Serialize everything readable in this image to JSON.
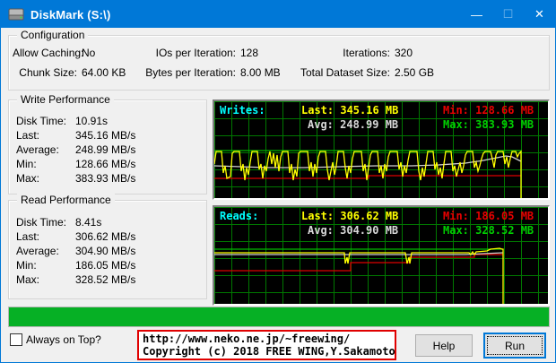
{
  "window": {
    "title": "DiskMark (S:\\)"
  },
  "titlebar": {
    "minimize_glyph": "—",
    "maximize_glyph": "☐",
    "close_glyph": "✕"
  },
  "configuration": {
    "legend": "Configuration",
    "fields": [
      {
        "label": "Allow Caching:",
        "value": "No"
      },
      {
        "label": "Chunk Size:",
        "value": "64.00 KB"
      },
      {
        "label": "IOs per Iteration:",
        "value": "128"
      },
      {
        "label": "Bytes per Iteration:",
        "value": "8.00 MB"
      },
      {
        "label": "Iterations:",
        "value": "320"
      },
      {
        "label": "Total Dataset Size:",
        "value": "2.50 GB"
      }
    ]
  },
  "write_performance": {
    "legend": "Write Performance",
    "rows": [
      {
        "label": "Disk Time:",
        "value": "10.91s"
      },
      {
        "label": "Last:",
        "value": "345.16 MB/s"
      },
      {
        "label": "Average:",
        "value": "248.99 MB/s"
      },
      {
        "label": "Min:",
        "value": "128.66 MB/s"
      },
      {
        "label": "Max:",
        "value": "383.93 MB/s"
      }
    ]
  },
  "read_performance": {
    "legend": "Read Performance",
    "rows": [
      {
        "label": "Disk Time:",
        "value": "8.41s"
      },
      {
        "label": "Last:",
        "value": "306.62 MB/s"
      },
      {
        "label": "Average:",
        "value": "304.90 MB/s"
      },
      {
        "label": "Min:",
        "value": "186.05 MB/s"
      },
      {
        "label": "Max:",
        "value": "328.52 MB/s"
      }
    ]
  },
  "write_graph": {
    "title": "Writes:",
    "last": "Last: 345.16 MB",
    "avg": "Avg: 248.99 MB",
    "min": "Min: 128.66 MB",
    "max": "Max: 383.93 MB",
    "series": {
      "max_line": "0,55 342,55",
      "min_line": "0,86 172,86 172,83 342,83",
      "avg_line": "0,72 30,73 60,74 100,74 140,73 180,72 220,72 250,71 280,69 300,66 315,63 325,61 332,62 338,65 342,67",
      "last_line": "0,70 2,56 8,56 10,80 12,72 14,86 18,84 20,58 22,56 28,56 30,78 32,70 34,88 36,74 38,82 40,68 42,56 48,56 50,76 52,70 54,86 56,72 58,78 60,64 62,56 64,70 66,58 68,74 70,60 72,78 74,62 76,56 82,56 84,80 86,70 88,88 90,76 92,84 94,58 96,56 104,56 106,78 108,68 110,84 112,70 114,80 116,62 118,56 124,56 126,76 128,88 130,78 132,68 134,82 136,72 138,56 144,56 146,74 148,86 150,72 152,80 154,64 156,56 164,56 166,78 168,70 170,88 172,74 174,60 176,56 182,56 184,80 186,72 188,86 190,70 192,78 194,62 196,56 204,56 206,76 208,68 210,84 212,72 214,80 216,66 218,56 226,56 228,78 230,88 232,74 234,84 236,70 238,56 244,56 246,76 248,68 250,82 252,74 254,86 256,70 258,56 264,56 266,78 268,72 270,84 272,76 274,68 276,80 278,72 280,60 282,56 288,56 290,74 292,68 294,78 296,72 298,64 300,58 302,56 308,56 310,64 312,74 314,60 316,56 322,56 324,70 326,62 328,74 330,64 332,56 336,56 338,62 340,58 342,56 342,108"
    }
  },
  "read_graph": {
    "title": "Reads:",
    "last": "Last: 306.62 MB",
    "avg": "Avg: 304.90 MB",
    "min": "Min: 186.05 MB",
    "max": "Max: 328.52 MB",
    "series": {
      "max_line": "0,47 322,47",
      "min_line": "0,71 152,71 152,62 218,62 218,56 290,56 290,53 322,53",
      "avg_line": "0,53 280,53 300,52 322,51",
      "last_line": "0,51 143,51 145,51 146,63 148,56 149,63 151,51 213,51 215,63 217,56 218,63 220,51 284,51 286,53 288,50 290,53 292,50 304,49 308,47 318,46 321,47 322,47 322,108"
    }
  },
  "progress": {
    "percent": "100",
    "bar_style": "width:100%"
  },
  "footer": {
    "always_on_top_label": "Always on Top?",
    "url_line1": "http://www.neko.ne.jp/~freewing/",
    "url_line2": "Copyright (c) 2018 FREE WING,Y.Sakamoto",
    "help_label": "Help",
    "run_label": "Run"
  },
  "colors": {
    "titlebar": "#0078d7",
    "graph_bg": "#000000",
    "graph_grid": "#007800",
    "series_cyan": "#00ffff",
    "series_yellow": "#ffff00",
    "series_white": "#d8d8d8",
    "series_red": "#e00000",
    "series_green": "#00c000",
    "progress_green": "#06b025"
  }
}
